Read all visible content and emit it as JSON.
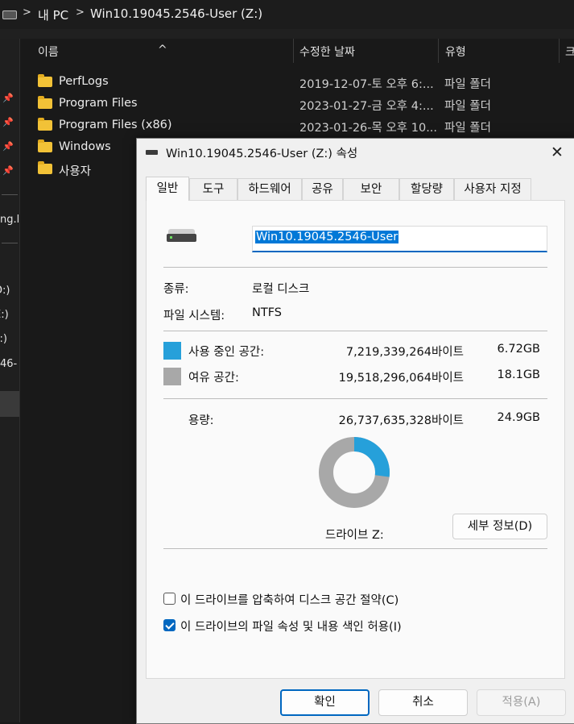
{
  "explorer": {
    "breadcrumb": [
      "내 PC",
      "Win10.19045.2546-User (Z:)"
    ],
    "columns": {
      "name": "이름",
      "modified": "수정한 날짜",
      "type": "유형"
    },
    "rows": [
      {
        "name": "PerfLogs",
        "modified": "2019-12-07-토 오후 6:...",
        "type": "파일 폴더"
      },
      {
        "name": "Program Files",
        "modified": "2023-01-27-금 오후 4:...",
        "type": "파일 폴더"
      },
      {
        "name": "Program Files (x86)",
        "modified": "2023-01-26-목 오후 10...",
        "type": "파일 폴더"
      },
      {
        "name": "Windows",
        "modified": "",
        "type": ""
      },
      {
        "name": "사용자",
        "modified": "",
        "type": ""
      }
    ],
    "nav_fragments": [
      "ng.l",
      "D:)",
      "E:)",
      "F:)",
      "46-"
    ]
  },
  "dialog": {
    "title": "Win10.19045.2546-User (Z:) 속성",
    "tabs": [
      "일반",
      "도구",
      "하드웨어",
      "공유",
      "보안",
      "할당량",
      "사용자 지정"
    ],
    "active_tab": "일반",
    "volume_name": "Win10.19045.2546-User",
    "type_label": "종류:",
    "type_value": "로컬 디스크",
    "fs_label": "파일 시스템:",
    "fs_value": "NTFS",
    "used_label": "사용 중인 공간:",
    "used_bytes": "7,219,339,264바이트",
    "used_gb": "6.72GB",
    "free_label": "여유 공간:",
    "free_bytes": "19,518,296,064바이트",
    "free_gb": "18.1GB",
    "capacity_label": "용량:",
    "capacity_bytes": "26,737,635,328바이트",
    "capacity_gb": "24.9GB",
    "used_fraction": 0.27,
    "drive_label": "드라이브 Z:",
    "details_button": "세부 정보(D)",
    "compress_label": "이 드라이브를 압축하여 디스크 공간 절약(C)",
    "compress_checked": false,
    "index_label": "이 드라이브의 파일 속성 및 내용 색인 허용(I)",
    "index_checked": true,
    "ok_button": "확인",
    "cancel_button": "취소",
    "apply_button": "적용(A)"
  },
  "colors": {
    "used": "#26a0da",
    "free": "#a8a8a8",
    "accent": "#0067c0"
  }
}
